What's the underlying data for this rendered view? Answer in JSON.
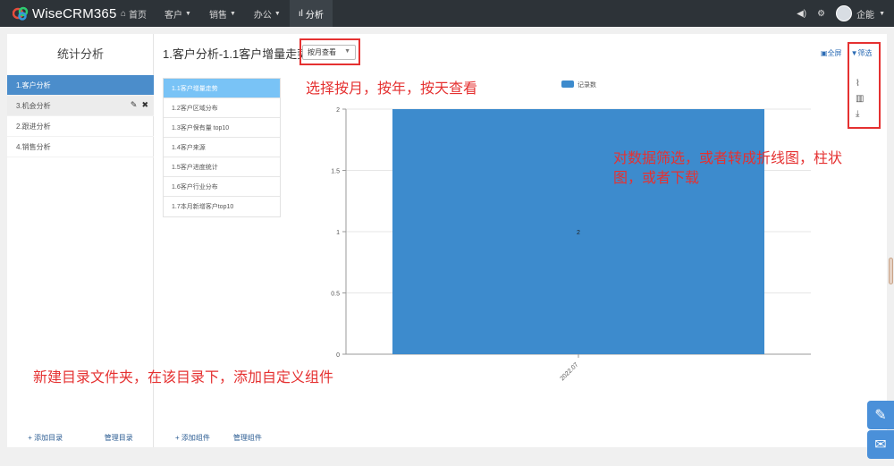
{
  "app": {
    "brand": "WiseCRM365",
    "nav": [
      {
        "label": "首页",
        "icon": "home-icon",
        "dropdown": false
      },
      {
        "label": "客户",
        "icon": "",
        "dropdown": true
      },
      {
        "label": "销售",
        "icon": "",
        "dropdown": true
      },
      {
        "label": "办公",
        "icon": "",
        "dropdown": true
      },
      {
        "label": "分析",
        "icon": "bar-chart-icon",
        "dropdown": false,
        "active": true
      }
    ],
    "user": "企能"
  },
  "left": {
    "title": "统计分析",
    "items": [
      {
        "label": "1.客户分析",
        "active": true
      },
      {
        "label": "3.机会分析",
        "hover": true
      },
      {
        "label": "2.跟进分析"
      },
      {
        "label": "4.销售分析"
      }
    ],
    "add_dir": "+ 添加目录",
    "manage_dir": "管理目录"
  },
  "main": {
    "title": "1.客户分析-1.1客户增量走势",
    "period_value": "按月查看",
    "fullscreen": "全屏",
    "filter": "筛选",
    "widgets": [
      "1.1客户增量走势",
      "1.2客户区域分布",
      "1.3客户保有量 top10",
      "1.4客户来源",
      "1.5客户进度统计",
      "1.6客户行业分布",
      "1.7本月新增客户top10"
    ],
    "add_widget": "+ 添加组件",
    "manage_widget": "管理组件"
  },
  "annotations": {
    "period_note": "选择按月，按年，按天查看",
    "filter_note_line1": "对数据筛选，或者转成折线图，柱状",
    "filter_note_line2": "图，或者下载",
    "dir_note": "新建目录文件夹，在该目录下，添加自定义组件"
  },
  "colors": {
    "topbar": "#2d3338",
    "accent": "#4b8dcb",
    "bar": "#3d8bcd",
    "annotation": "#e53131"
  },
  "chart_data": {
    "type": "bar",
    "categories": [
      "2022.07"
    ],
    "series": [
      {
        "name": "记录数",
        "values": [
          2
        ]
      }
    ],
    "yticks": [
      "0",
      "0.5",
      "1",
      "1.5",
      "2"
    ],
    "ylim": [
      0,
      2
    ],
    "data_labels": [
      "2"
    ],
    "legend_position": "top",
    "grid": true
  }
}
